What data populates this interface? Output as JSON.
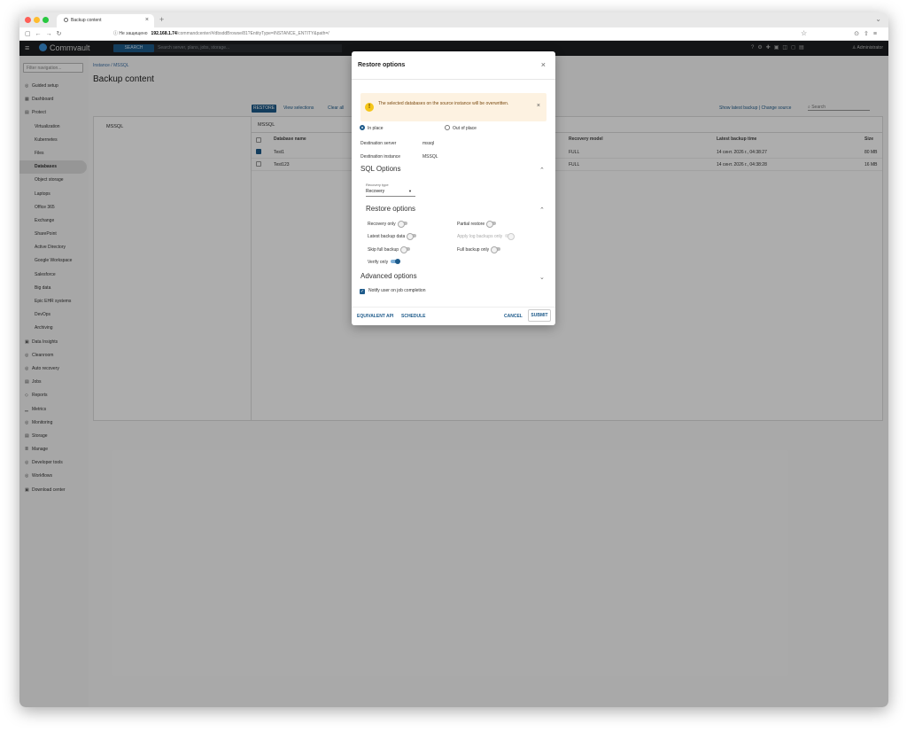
{
  "browser": {
    "tab_title": "Backup content",
    "insecure_label": "Не защищено",
    "url_host": "192.168.1.74",
    "url_path": "/commandcenter/#/dbsddBrowse/81?EntityType=INSTANCE_ENTITY&path=/"
  },
  "header": {
    "brand": "Commvault",
    "search_button": "SEARCH",
    "search_placeholder": "Search server, plans, jobs, storage...",
    "user": "Administrator"
  },
  "sidebar": {
    "filter_placeholder": "Filter navigation...",
    "items": [
      {
        "label": "Guided setup",
        "icon": "◎",
        "level": 0
      },
      {
        "label": "Dashboard",
        "icon": "▦",
        "level": 0
      },
      {
        "label": "Protect",
        "icon": "▤",
        "level": 0
      },
      {
        "label": "Virtualization",
        "level": 1
      },
      {
        "label": "Kubernetes",
        "level": 1
      },
      {
        "label": "Files",
        "level": 1
      },
      {
        "label": "Databases",
        "level": 1,
        "active": true
      },
      {
        "label": "Object storage",
        "level": 1
      },
      {
        "label": "Laptops",
        "level": 1
      },
      {
        "label": "Office 365",
        "level": 1
      },
      {
        "label": "Exchange",
        "level": 1
      },
      {
        "label": "SharePoint",
        "level": 1
      },
      {
        "label": "Active Directory",
        "level": 1
      },
      {
        "label": "Google Workspace",
        "level": 1
      },
      {
        "label": "Salesforce",
        "level": 1
      },
      {
        "label": "Big data",
        "level": 1
      },
      {
        "label": "Epic EHR systems",
        "level": 1
      },
      {
        "label": "DevOps",
        "level": 1
      },
      {
        "label": "Archiving",
        "level": 1
      },
      {
        "label": "Data Insights",
        "icon": "▣",
        "level": 0
      },
      {
        "label": "Cleanroom",
        "icon": "◎",
        "level": 0
      },
      {
        "label": "Auto recovery",
        "icon": "◎",
        "level": 0
      },
      {
        "label": "Jobs",
        "icon": "▤",
        "level": 0
      },
      {
        "label": "Reports",
        "icon": "◇",
        "level": 0
      },
      {
        "label": "Metrics",
        "icon": "▁",
        "level": 0
      },
      {
        "label": "Monitoring",
        "icon": "◎",
        "level": 0
      },
      {
        "label": "Storage",
        "icon": "▤",
        "level": 0
      },
      {
        "label": "Manage",
        "icon": "≣",
        "level": 0
      },
      {
        "label": "Developer tools",
        "icon": "◎",
        "level": 0
      },
      {
        "label": "Workflows",
        "icon": "◎",
        "level": 0
      },
      {
        "label": "Download center",
        "icon": "▣",
        "level": 0
      }
    ]
  },
  "page": {
    "breadcrumb": "Instance / MSSQL",
    "title": "Backup content",
    "restore_button": "RESTORE",
    "view_selections": "View selections",
    "clear_all": "Clear all",
    "show_latest": "Show latest backup",
    "change_source": "Change source",
    "search_placeholder": "Search",
    "left_pane_label": "MSSQL",
    "right_pane_label": "MSSQL",
    "columns": [
      "Database name",
      "Recovery model",
      "Latest backup time",
      "Size"
    ],
    "rows": [
      {
        "name": "Test1",
        "recovery": "FULL",
        "time": "14 сент. 2026 г., 04:38:27",
        "size": "80 MB",
        "checked": true
      },
      {
        "name": "Test123",
        "recovery": "FULL",
        "time": "14 сент. 2026 г., 04:38:28",
        "size": "16 MB",
        "checked": false
      }
    ]
  },
  "modal": {
    "title": "Restore options",
    "warning": "The selected databases on the source instance will be overwritten.",
    "in_place": "In place",
    "out_of_place": "Out of place",
    "dest_server_label": "Destination server",
    "dest_server_value": "mssql",
    "dest_instance_label": "Destination instance",
    "dest_instance_value": "MSSQL",
    "sql_options": "SQL Options",
    "recovery_type_label": "Recovery type",
    "recovery_type_value": "Recovery",
    "restore_options": "Restore options",
    "opt_recovery_only": "Recovery only",
    "opt_partial_restore": "Partial restore",
    "opt_latest_backup_data": "Latest backup data",
    "opt_apply_log_backups_only": "Apply log backups only",
    "opt_skip_full_backup": "Skip full backup",
    "opt_full_backup_only": "Full backup only",
    "opt_verify_only": "Verify only",
    "advanced_options": "Advanced options",
    "notify": "Notify user on job completion",
    "equivalent_api": "EQUIVALENT API",
    "schedule": "SCHEDULE",
    "cancel": "CANCEL",
    "submit": "SUBMIT"
  },
  "colors": {
    "primary": "#1d5a8a",
    "header_bg": "#1c1e21",
    "warning_bg": "#fdf2e1"
  }
}
